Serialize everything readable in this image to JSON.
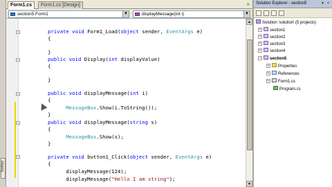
{
  "tabs": [
    {
      "label": "Form1.cs",
      "active": true
    },
    {
      "label": "Form1.cs [Design]",
      "active": false
    }
  ],
  "tab_close": "×",
  "member_bar": {
    "class_combo": "section5.Form1",
    "member_combo": "displayMessage(int i)"
  },
  "editor": {
    "lines": [
      "private void Form1_Load(object sender, EventArgs e)",
      "{",
      "}",
      "public void Display(int displayValue)",
      "{",
      "}",
      "public void displayMessage(int i)",
      "{",
      "MessageBox.Show(i.ToString());",
      "}",
      "public void displayMessage(string s)",
      "{",
      "MessageBox.Show(s);",
      "}",
      "private void button1_Click(object sender, EventArgs e)",
      "{",
      "displayMessage(124);",
      "displayMessage(\"Hello I am string\");"
    ]
  },
  "toolbox_label": "Toolbox",
  "solution_explorer": {
    "title": "Solution Explorer - section5",
    "tree": [
      "Solution 'solution' (5 projects)",
      "section1",
      "section2",
      "section3",
      "section4",
      "section5",
      "Properties",
      "References",
      "Form1.cs",
      "Program.cs"
    ]
  },
  "colors": {
    "keyword": "#0000ff",
    "type": "#2b91af",
    "string": "#a31515"
  }
}
